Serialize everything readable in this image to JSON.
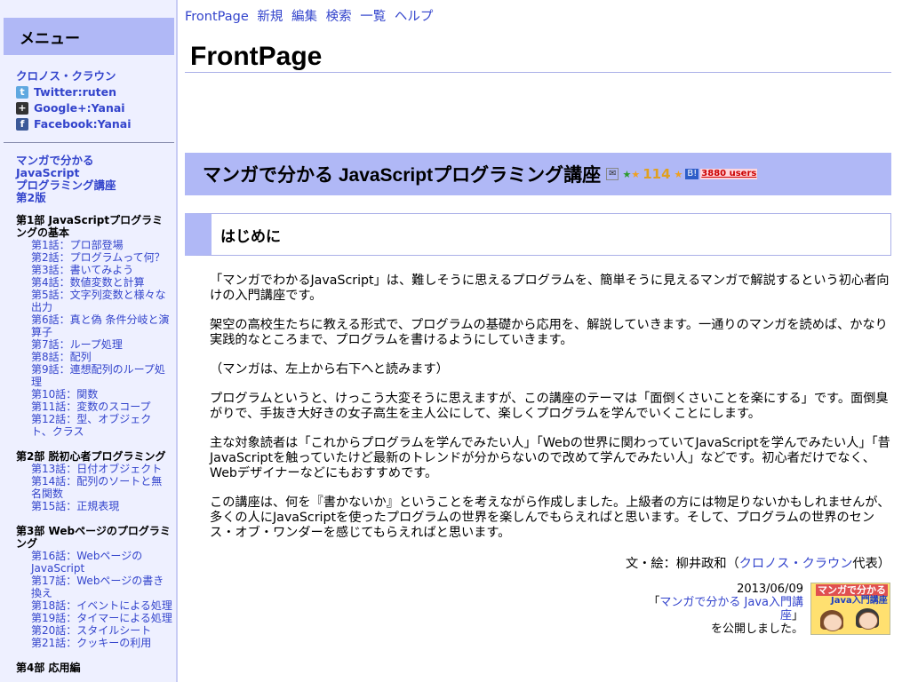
{
  "sidebar": {
    "menu_title": "メニュー",
    "site_link": "クロノス・クラウン",
    "social": [
      {
        "icon": "twitter-icon",
        "label": "Twitter:ruten"
      },
      {
        "icon": "google-plus-icon",
        "label": "Google+:Yanai"
      },
      {
        "icon": "facebook-icon",
        "label": "Facebook:Yanai"
      }
    ],
    "book_title": [
      "マンガで分かる",
      "JavaScript",
      "プログラミング講座",
      "第2版"
    ],
    "parts": [
      {
        "title": "第1部 JavaScriptプログラミングの基本",
        "items": [
          "第1話：プロ部登場",
          "第2話：プログラムって何？",
          "第3話：書いてみよう",
          "第4話：数値変数と計算",
          "第5話：文字列変数と様々な出力",
          "第6話：真と偽 条件分岐と演算子",
          "第7話：ループ処理",
          "第8話：配列",
          "第9話：連想配列のループ処理",
          "第10話：関数",
          "第11話：変数のスコープ",
          "第12話：型、オブジェクト、クラス"
        ]
      },
      {
        "title": "第2部 脱初心者プログラミング",
        "items": [
          "第13話：日付オブジェクト",
          "第14話：配列のソートと無名関数",
          "第15話：正規表現"
        ]
      },
      {
        "title": "第3部 Webページのプログラミング",
        "items": [
          "第16話：Webページの JavaScript",
          "第17話：Webページの書き換え",
          "第18話：イベントによる処理",
          "第19話：タイマーによる処理",
          "第20話：スタイルシート",
          "第21話：クッキーの利用"
        ]
      },
      {
        "title": "第4部 応用編",
        "items": []
      }
    ]
  },
  "topnav": [
    "FrontPage",
    "新規",
    "編集",
    "検索",
    "一覧",
    "ヘルプ"
  ],
  "page_title": "FrontPage",
  "h2": {
    "title": "マンガで分かる JavaScriptプログラミング講座",
    "star_count": "114",
    "users": "3880 users"
  },
  "h3": "はじめに",
  "paragraphs": [
    "「マンガでわかるJavaScript」は、難しそうに思えるプログラムを、簡単そうに見えるマンガで解説するという初心者向けの入門講座です。",
    "架空の高校生たちに教える形式で、プログラムの基礎から応用を、解説していきます。一通りのマンガを読めば、かなり実践的なところまで、プログラムを書けるようにしていきます。",
    "（マンガは、左上から右下へと読みます）",
    "プログラムというと、けっこう大変そうに思えますが、この講座のテーマは「面倒くさいことを楽にする」です。面倒臭がりで、手抜き大好きの女子高生を主人公にして、楽しくプログラムを学んでいくことにします。",
    "主な対象読者は「これからプログラムを学んでみたい人」「Webの世界に関わっていてJavaScriptを学んでみたい人」「昔JavaScriptを触っていたけど最新のトレンドが分からないので改めて学んでみたい人」などです。初心者だけでなく、Webデザイナーなどにもおすすめです。",
    "この講座は、何を『書かないか』ということを考えながら作成しました。上級者の方には物足りないかもしれませんが、多くの人にJavaScriptを使ったプログラムの世界を楽しんでもらえればと思います。そして、プログラムの世界のセンス・オブ・ワンダーを感じてもらえればと思います。"
  ],
  "signature": {
    "prefix": "文・絵：柳井政和（",
    "link": "クロノス・クラウン",
    "suffix": "代表）"
  },
  "news": {
    "date": "2013/06/09",
    "open": "「",
    "link": "マンガで分かる Java入門講座",
    "close": "」",
    "tail": "を公開しました。",
    "thumb_line1": "マンガで分かる",
    "thumb_line2": "Java入門講座"
  }
}
